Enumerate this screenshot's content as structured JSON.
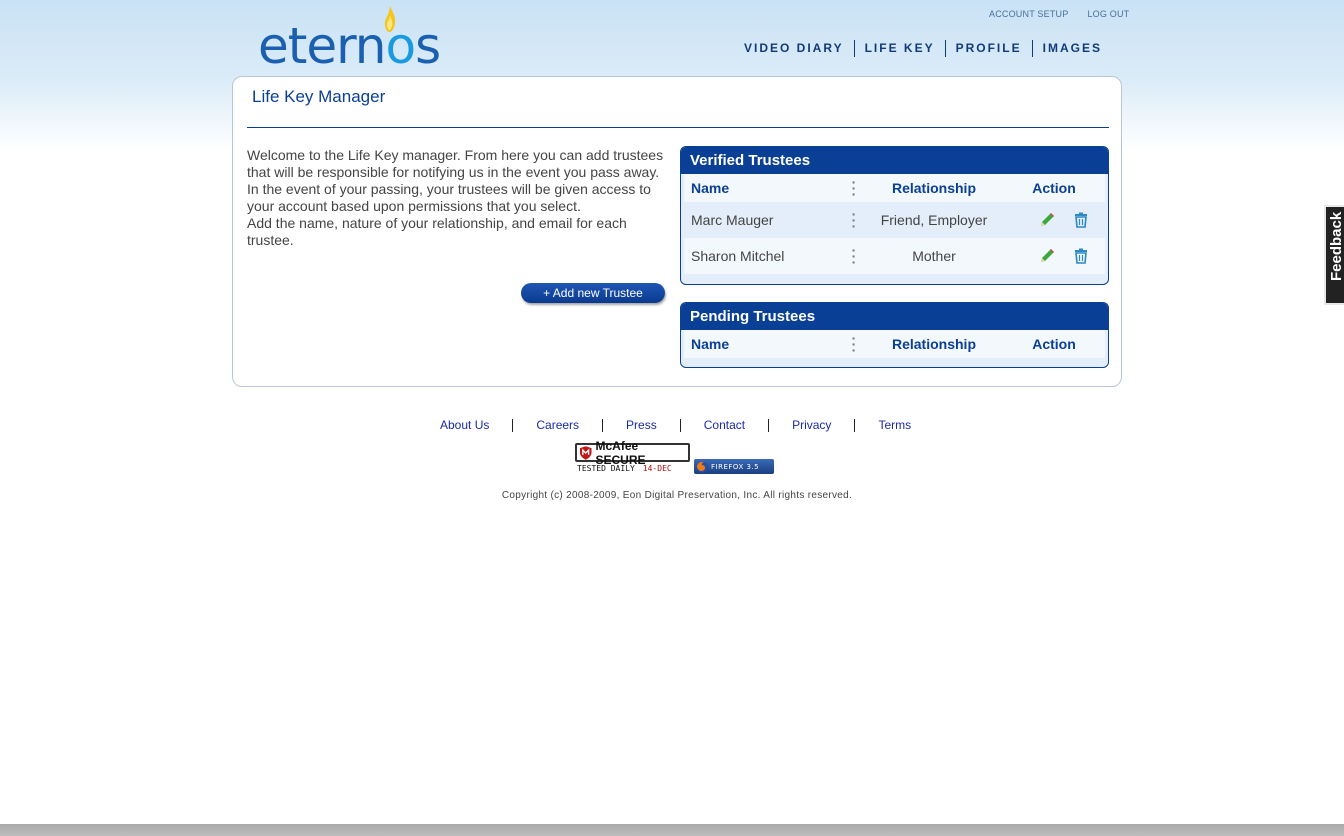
{
  "brand": {
    "logo_text_pre": "etern",
    "logo_text_o": "o",
    "logo_text_post": "s"
  },
  "top_links": [
    "ACCOUNT SETUP",
    "LOG OUT"
  ],
  "nav": [
    "VIDEO DIARY",
    "LIFE KEY",
    "PROFILE",
    "IMAGES"
  ],
  "page": {
    "title": "Life Key Manager",
    "intro": [
      "Welcome to the Life Key manager. From here you can add trustees that will be responsible for notifying us in the event you pass away.",
      "In the event of your passing, your trustees will be given access to your account based upon permissions that you select.",
      "Add the name, nature of your relationship, and email for each trustee."
    ],
    "add_button": "+ Add new Trustee"
  },
  "verified": {
    "title": "Verified Trustees",
    "headers": {
      "name": "Name",
      "relationship": "Relationship",
      "action": "Action"
    },
    "rows": [
      {
        "name": "Marc Mauger",
        "relationship": "Friend, Employer"
      },
      {
        "name": "Sharon Mitchel",
        "relationship": "Mother"
      }
    ]
  },
  "pending": {
    "title": "Pending Trustees",
    "headers": {
      "name": "Name",
      "relationship": "Relationship",
      "action": "Action"
    }
  },
  "footer": {
    "links": [
      "About Us",
      "Careers",
      "Press",
      "Contact",
      "Privacy",
      "Terms"
    ],
    "mcafee_label": "McAfee SECURE",
    "mcafee_tested": "TESTED DAILY",
    "mcafee_date": "14-DEC",
    "firefox_label": "FIREFOX 3.5",
    "copyright": "Copyright (c) 2008-2009, Eon Digital Preservation, Inc. All rights reserved."
  },
  "feedback_label": "Feedback",
  "colors": {
    "brand_blue": "#0a3f96",
    "nav_text": "#123a7a",
    "link_blue": "#1a2ba8",
    "edit_green": "#3aa83a",
    "delete_blue": "#2a8ac8"
  },
  "icons": [
    "flame-icon",
    "edit-pencil-icon",
    "delete-trash-icon",
    "mcafee-shield-icon",
    "firefox-icon"
  ]
}
